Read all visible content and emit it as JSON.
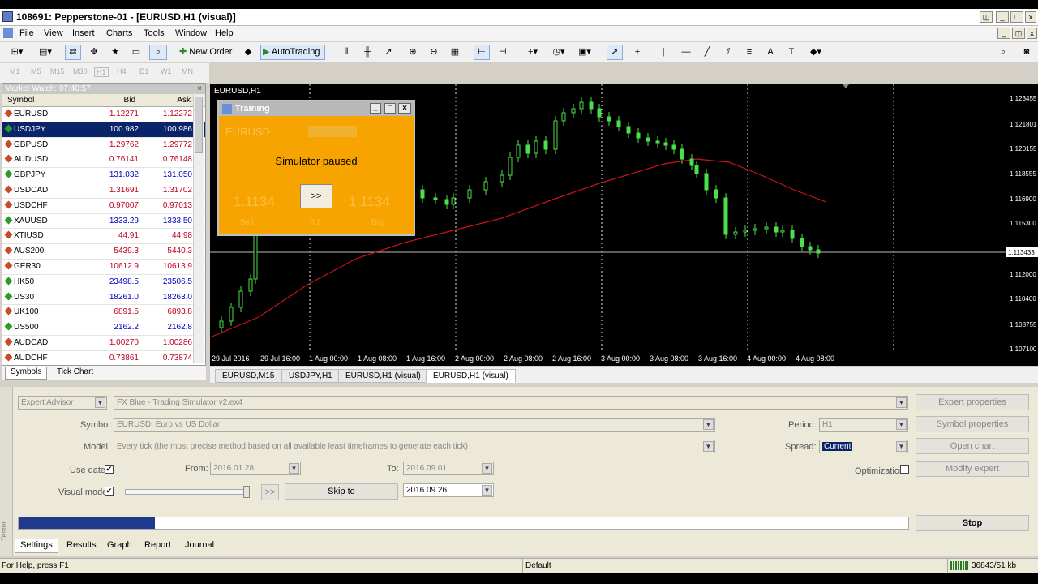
{
  "window": {
    "title": "108691: Pepperstone-01 - [EURUSD,H1 (visual)]"
  },
  "menu": [
    "File",
    "View",
    "Insert",
    "Charts",
    "Tools",
    "Window",
    "Help"
  ],
  "toolbar": {
    "new_order": "New Order",
    "autotrading": "AutoTrading"
  },
  "timeframes": [
    "M1",
    "M5",
    "M15",
    "M30",
    "H1",
    "H4",
    "D1",
    "W1",
    "MN"
  ],
  "market_watch": {
    "title": "Market Watch: 07:40:57",
    "col_symbol": "Symbol",
    "col_bid": "Bid",
    "col_ask": "Ask",
    "rows": [
      {
        "symbol": "EURUSD",
        "bid": "1.12271",
        "ask": "1.12272",
        "dir": "down"
      },
      {
        "symbol": "USDJPY",
        "bid": "100.982",
        "ask": "100.986",
        "dir": "up"
      },
      {
        "symbol": "GBPUSD",
        "bid": "1.29762",
        "ask": "1.29772",
        "dir": "down"
      },
      {
        "symbol": "AUDUSD",
        "bid": "0.76141",
        "ask": "0.76148",
        "dir": "down"
      },
      {
        "symbol": "GBPJPY",
        "bid": "131.032",
        "ask": "131.050",
        "dir": "up"
      },
      {
        "symbol": "USDCAD",
        "bid": "1.31691",
        "ask": "1.31702",
        "dir": "down"
      },
      {
        "symbol": "USDCHF",
        "bid": "0.97007",
        "ask": "0.97013",
        "dir": "down"
      },
      {
        "symbol": "XAUUSD",
        "bid": "1333.29",
        "ask": "1333.50",
        "dir": "up"
      },
      {
        "symbol": "XTIUSD",
        "bid": "44.91",
        "ask": "44.98",
        "dir": "down"
      },
      {
        "symbol": "AUS200",
        "bid": "5439.3",
        "ask": "5440.3",
        "dir": "down"
      },
      {
        "symbol": "GER30",
        "bid": "10612.9",
        "ask": "10613.9",
        "dir": "down"
      },
      {
        "symbol": "HK50",
        "bid": "23498.5",
        "ask": "23506.5",
        "dir": "up"
      },
      {
        "symbol": "US30",
        "bid": "18261.0",
        "ask": "18263.0",
        "dir": "up"
      },
      {
        "symbol": "UK100",
        "bid": "6891.5",
        "ask": "6893.8",
        "dir": "down"
      },
      {
        "symbol": "US500",
        "bid": "2162.2",
        "ask": "2162.8",
        "dir": "up"
      },
      {
        "symbol": "AUDCAD",
        "bid": "1.00270",
        "ask": "1.00286",
        "dir": "down"
      },
      {
        "symbol": "AUDCHF",
        "bid": "0.73861",
        "ask": "0.73874",
        "dir": "down"
      }
    ],
    "tab_symbols": "Symbols",
    "tab_tick": "Tick Chart"
  },
  "chart": {
    "label": "EURUSD,H1",
    "price_ticks": [
      "1.123455",
      "1.121801",
      "1.120155",
      "1.118555",
      "1.116900",
      "1.115300",
      "1.113433",
      "1.112000",
      "1.110400",
      "1.108755",
      "1.107100"
    ],
    "current_price": "1.113433",
    "time_ticks": [
      "29 Jul 2016",
      "29 Jul 16:00",
      "1 Aug 00:00",
      "1 Aug 08:00",
      "1 Aug 16:00",
      "2 Aug 00:00",
      "2 Aug 08:00",
      "2 Aug 16:00",
      "3 Aug 00:00",
      "3 Aug 08:00",
      "3 Aug 16:00",
      "4 Aug 00:00",
      "4 Aug 08:00"
    ],
    "tabs": [
      "EURUSD,M15",
      "USDJPY,H1",
      "EURUSD,H1 (visual)",
      "EURUSD,H1 (visual)"
    ]
  },
  "training": {
    "title": "Training",
    "message": "Simulator paused",
    "button": ">>",
    "bg_symbol": "EURUSD",
    "bg_sell": "Sell",
    "bg_buy": "Buy",
    "bg_lot": "0.2",
    "bg_bid": "1.1134",
    "bg_ask": "1.1134"
  },
  "tester": {
    "mode": "Expert Advisor",
    "expert": "FX Blue - Trading Simulator v2.ex4",
    "symbol_label": "Symbol:",
    "symbol": "EURUSD, Euro vs US Dollar",
    "model_label": "Model:",
    "model": "Every tick (the most precise method based on all available least timeframes to generate each tick)",
    "period_label": "Period:",
    "period": "H1",
    "spread_label": "Spread:",
    "spread": "Current",
    "use_date_label": "Use date",
    "from_label": "From:",
    "from": "2016.01.28",
    "to_label": "To:",
    "to": "2016.09.01",
    "optimization_label": "Optimization",
    "visual_mode_label": "Visual mode",
    "skip_button": "Skip to",
    "skip_date": "2016.09.26",
    "fast_button": ">>",
    "btn_expert_props": "Expert properties",
    "btn_symbol_props": "Symbol properties",
    "btn_open_chart": "Open chart",
    "btn_modify_expert": "Modify expert",
    "btn_stop": "Stop",
    "progress": 0.153,
    "tabs": [
      "Settings",
      "Results",
      "Graph",
      "Report",
      "Journal"
    ],
    "side_label": "Tester"
  },
  "status": {
    "help": "For Help, press F1",
    "profile": "Default",
    "traffic": "36843/51 kb"
  }
}
